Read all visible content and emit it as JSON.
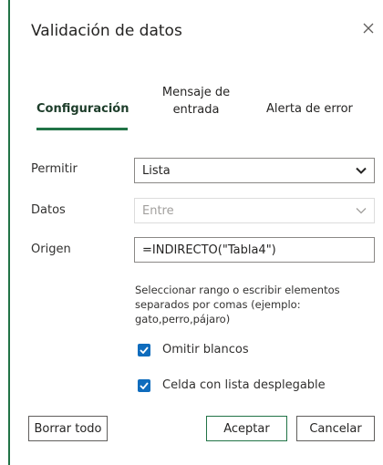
{
  "dialog": {
    "title": "Validación de datos",
    "accent_color": "#217346"
  },
  "tabs": {
    "config": "Configuración",
    "input_message": "Mensaje de entrada",
    "error_alert": "Alerta de error"
  },
  "form": {
    "allow_label": "Permitir",
    "allow_value": "Lista",
    "data_label": "Datos",
    "data_value": "Entre",
    "source_label": "Origen",
    "source_value": "=INDIRECTO(\"Tabla4\")",
    "help_text": "Seleccionar rango o escribir elementos separados por comas (ejemplo: gato,perro,pájaro)"
  },
  "options": {
    "ignore_blank": "Omitir blancos",
    "in_cell_dropdown": "Celda con lista desplegable",
    "checkbox_color": "#0f6cbd"
  },
  "buttons": {
    "clear_all": "Borrar todo",
    "ok": "Aceptar",
    "cancel": "Cancelar"
  }
}
